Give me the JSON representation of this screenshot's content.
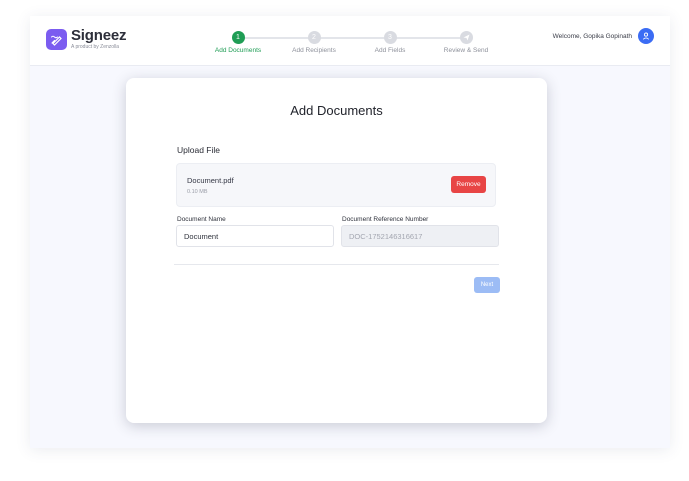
{
  "brand": {
    "name": "Signeez",
    "subtitle": "A product by Zenzolla",
    "accent": "#7b5cf0"
  },
  "stepper": {
    "steps": [
      {
        "number": "1",
        "label": "Add Documents",
        "state": "active"
      },
      {
        "number": "2",
        "label": "Add Recipients",
        "state": "pending"
      },
      {
        "number": "3",
        "label": "Add Fields",
        "state": "pending"
      },
      {
        "number": "",
        "label": "Review & Send",
        "state": "pending"
      }
    ],
    "active_color": "#1f9d55",
    "inactive_color": "#d9dbe1"
  },
  "user": {
    "welcome_text": "Welcome, Gopika Gopinath",
    "avatar_icon": "user-icon",
    "avatar_color": "#3b6cf4"
  },
  "card": {
    "title": "Add Documents",
    "upload_label": "Upload File",
    "file": {
      "name": "Document.pdf",
      "size": "0.10 MB",
      "remove_label": "Remove",
      "remove_color": "#e84545"
    },
    "fields": {
      "document_name_label": "Document Name",
      "document_name_value": "Document",
      "reference_label": "Document Reference Number",
      "reference_value": "DOC-1752146316617"
    },
    "next_label": "Next",
    "next_color": "#9cbcf5"
  }
}
